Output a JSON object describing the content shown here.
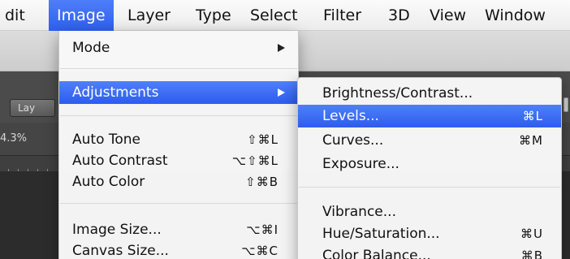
{
  "menubar": {
    "items": [
      "dit",
      "Image",
      "Layer",
      "Type",
      "Select",
      "Filter",
      "3D",
      "View",
      "Window"
    ],
    "active": "Image"
  },
  "app": {
    "layer_button": "Lay",
    "zoom": "4.3%"
  },
  "image_menu": {
    "items": [
      {
        "label": "Mode",
        "submenu": true
      },
      {
        "label": "Adjustments",
        "submenu": true,
        "highlighted": true
      },
      {
        "label": "Auto Tone",
        "shortcut": "⇧⌘L"
      },
      {
        "label": "Auto Contrast",
        "shortcut": "⌥⇧⌘L"
      },
      {
        "label": "Auto Color",
        "shortcut": "⇧⌘B"
      },
      {
        "label": "Image Size...",
        "shortcut": "⌥⌘I"
      },
      {
        "label": "Canvas Size...",
        "shortcut": "⌥⌘C"
      }
    ]
  },
  "adjustments_menu": {
    "items": [
      {
        "label": "Brightness/Contrast..."
      },
      {
        "label": "Levels...",
        "shortcut": "⌘L",
        "highlighted": true
      },
      {
        "label": "Curves...",
        "shortcut": "⌘M"
      },
      {
        "label": "Exposure..."
      },
      {
        "label": "Vibrance..."
      },
      {
        "label": "Hue/Saturation...",
        "shortcut": "⌘U"
      },
      {
        "label": "Color Balance...",
        "shortcut": "⌘B"
      }
    ]
  },
  "colors": {
    "highlight": "#2f5ff0",
    "menu_background": "#f7f7f7"
  }
}
